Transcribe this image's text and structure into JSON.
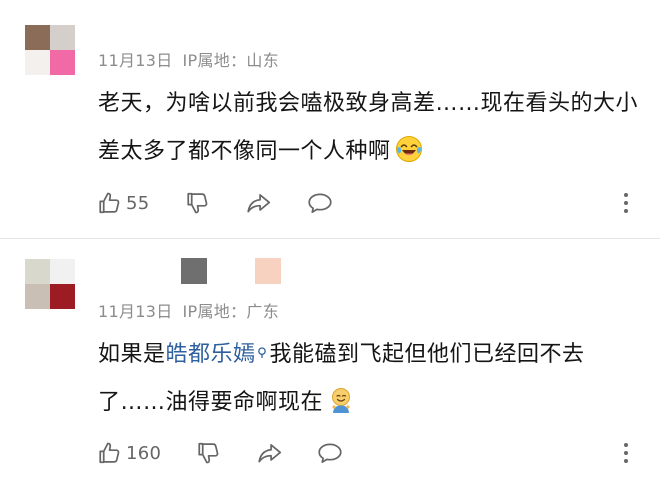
{
  "comments": [
    {
      "date": "11月13日",
      "ip_label": "IP属地：",
      "location": "山东",
      "text": "老天，为啥以前我会嗑极致身高差……现在看头的大小差太多了都不像同一个人种啊",
      "emoji": "crying-laughing-face-emoji",
      "likes": "55",
      "avatar_colors": [
        "#8a6c58",
        "#d4cfcb",
        "#f3f0ee",
        "#f26aa5"
      ]
    },
    {
      "date": "11月13日",
      "ip_label": "IP属地：",
      "location": "广东",
      "text_before": "如果是",
      "mention": "皓都乐嫣",
      "text_after": "我能磕到飞起但他们已经回不去了……油得要命啊现在",
      "emoji": "smiling-face-emoji",
      "likes": "160",
      "avatar_colors": [
        "#d8d9cc",
        "#f1f1f1",
        "#c9bfb5",
        "#9d1b22"
      ],
      "name_block_colors": [
        "#6f6f6f",
        "#f8d2c0"
      ]
    }
  ],
  "icons": {
    "like": "thumbs-up-icon",
    "dislike": "thumbs-down-icon",
    "share": "share-arrow-icon",
    "reply": "reply-bubble-icon",
    "more": "more-vertical-icon"
  },
  "colors": {
    "meta": "#8c8c8c",
    "mention": "#2e5f9e",
    "action": "#666666",
    "divider": "#e6e6e6"
  }
}
